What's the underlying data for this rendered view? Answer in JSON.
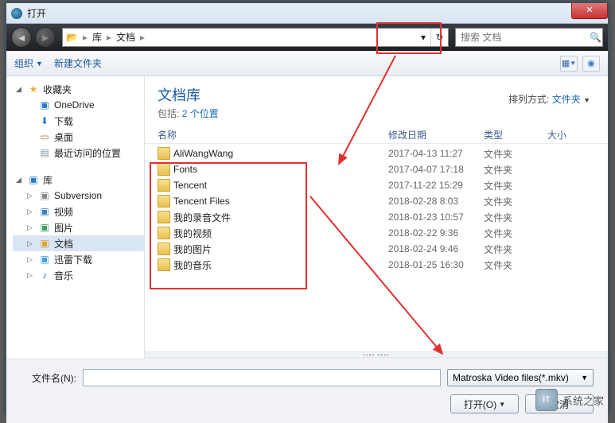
{
  "window": {
    "title": "打开"
  },
  "nav": {
    "path": [
      "库",
      "文档"
    ],
    "search_placeholder": "搜索 文档"
  },
  "toolbar": {
    "organize": "组织",
    "newfolder": "新建文件夹"
  },
  "sidebar": {
    "favorites": {
      "label": "收藏夹",
      "items": [
        {
          "key": "onedrive",
          "label": "OneDrive"
        },
        {
          "key": "downloads",
          "label": "下载"
        },
        {
          "key": "desktop",
          "label": "桌面"
        },
        {
          "key": "recent",
          "label": "最近访问的位置"
        }
      ]
    },
    "libraries": {
      "label": "库",
      "items": [
        {
          "key": "subversion",
          "label": "Subversion"
        },
        {
          "key": "videos",
          "label": "视频"
        },
        {
          "key": "pictures",
          "label": "图片"
        },
        {
          "key": "documents",
          "label": "文档",
          "selected": true
        },
        {
          "key": "xunlei",
          "label": "迅雷下载"
        },
        {
          "key": "music",
          "label": "音乐"
        }
      ]
    }
  },
  "library_header": {
    "title": "文档库",
    "subtitle_prefix": "包括:",
    "subtitle_link": "2 个位置",
    "arrange_label": "排列方式:",
    "arrange_value": "文件夹"
  },
  "columns": {
    "name": "名称",
    "modified": "修改日期",
    "type": "类型",
    "size": "大小"
  },
  "files": [
    {
      "name": "AliWangWang",
      "date": "2017-04-13 11:27",
      "type": "文件夹"
    },
    {
      "name": "Fonts",
      "date": "2017-04-07 17:18",
      "type": "文件夹"
    },
    {
      "name": "Tencent",
      "date": "2017-11-22 15:29",
      "type": "文件夹"
    },
    {
      "name": "Tencent Files",
      "date": "2018-02-28 8:03",
      "type": "文件夹"
    },
    {
      "name": "我的录音文件",
      "date": "2018-01-23 10:57",
      "type": "文件夹"
    },
    {
      "name": "我的视频",
      "date": "2018-02-22 9:36",
      "type": "文件夹"
    },
    {
      "name": "我的图片",
      "date": "2018-02-24 9:46",
      "type": "文件夹"
    },
    {
      "name": "我的音乐",
      "date": "2018-01-25 16:30",
      "type": "文件夹"
    }
  ],
  "footer": {
    "filename_label": "文件名(N):",
    "filename_value": "",
    "filetype": "Matroska Video files(*.mkv)",
    "open": "打开(O)",
    "cancel": "取消"
  },
  "watermark": "系统之家"
}
